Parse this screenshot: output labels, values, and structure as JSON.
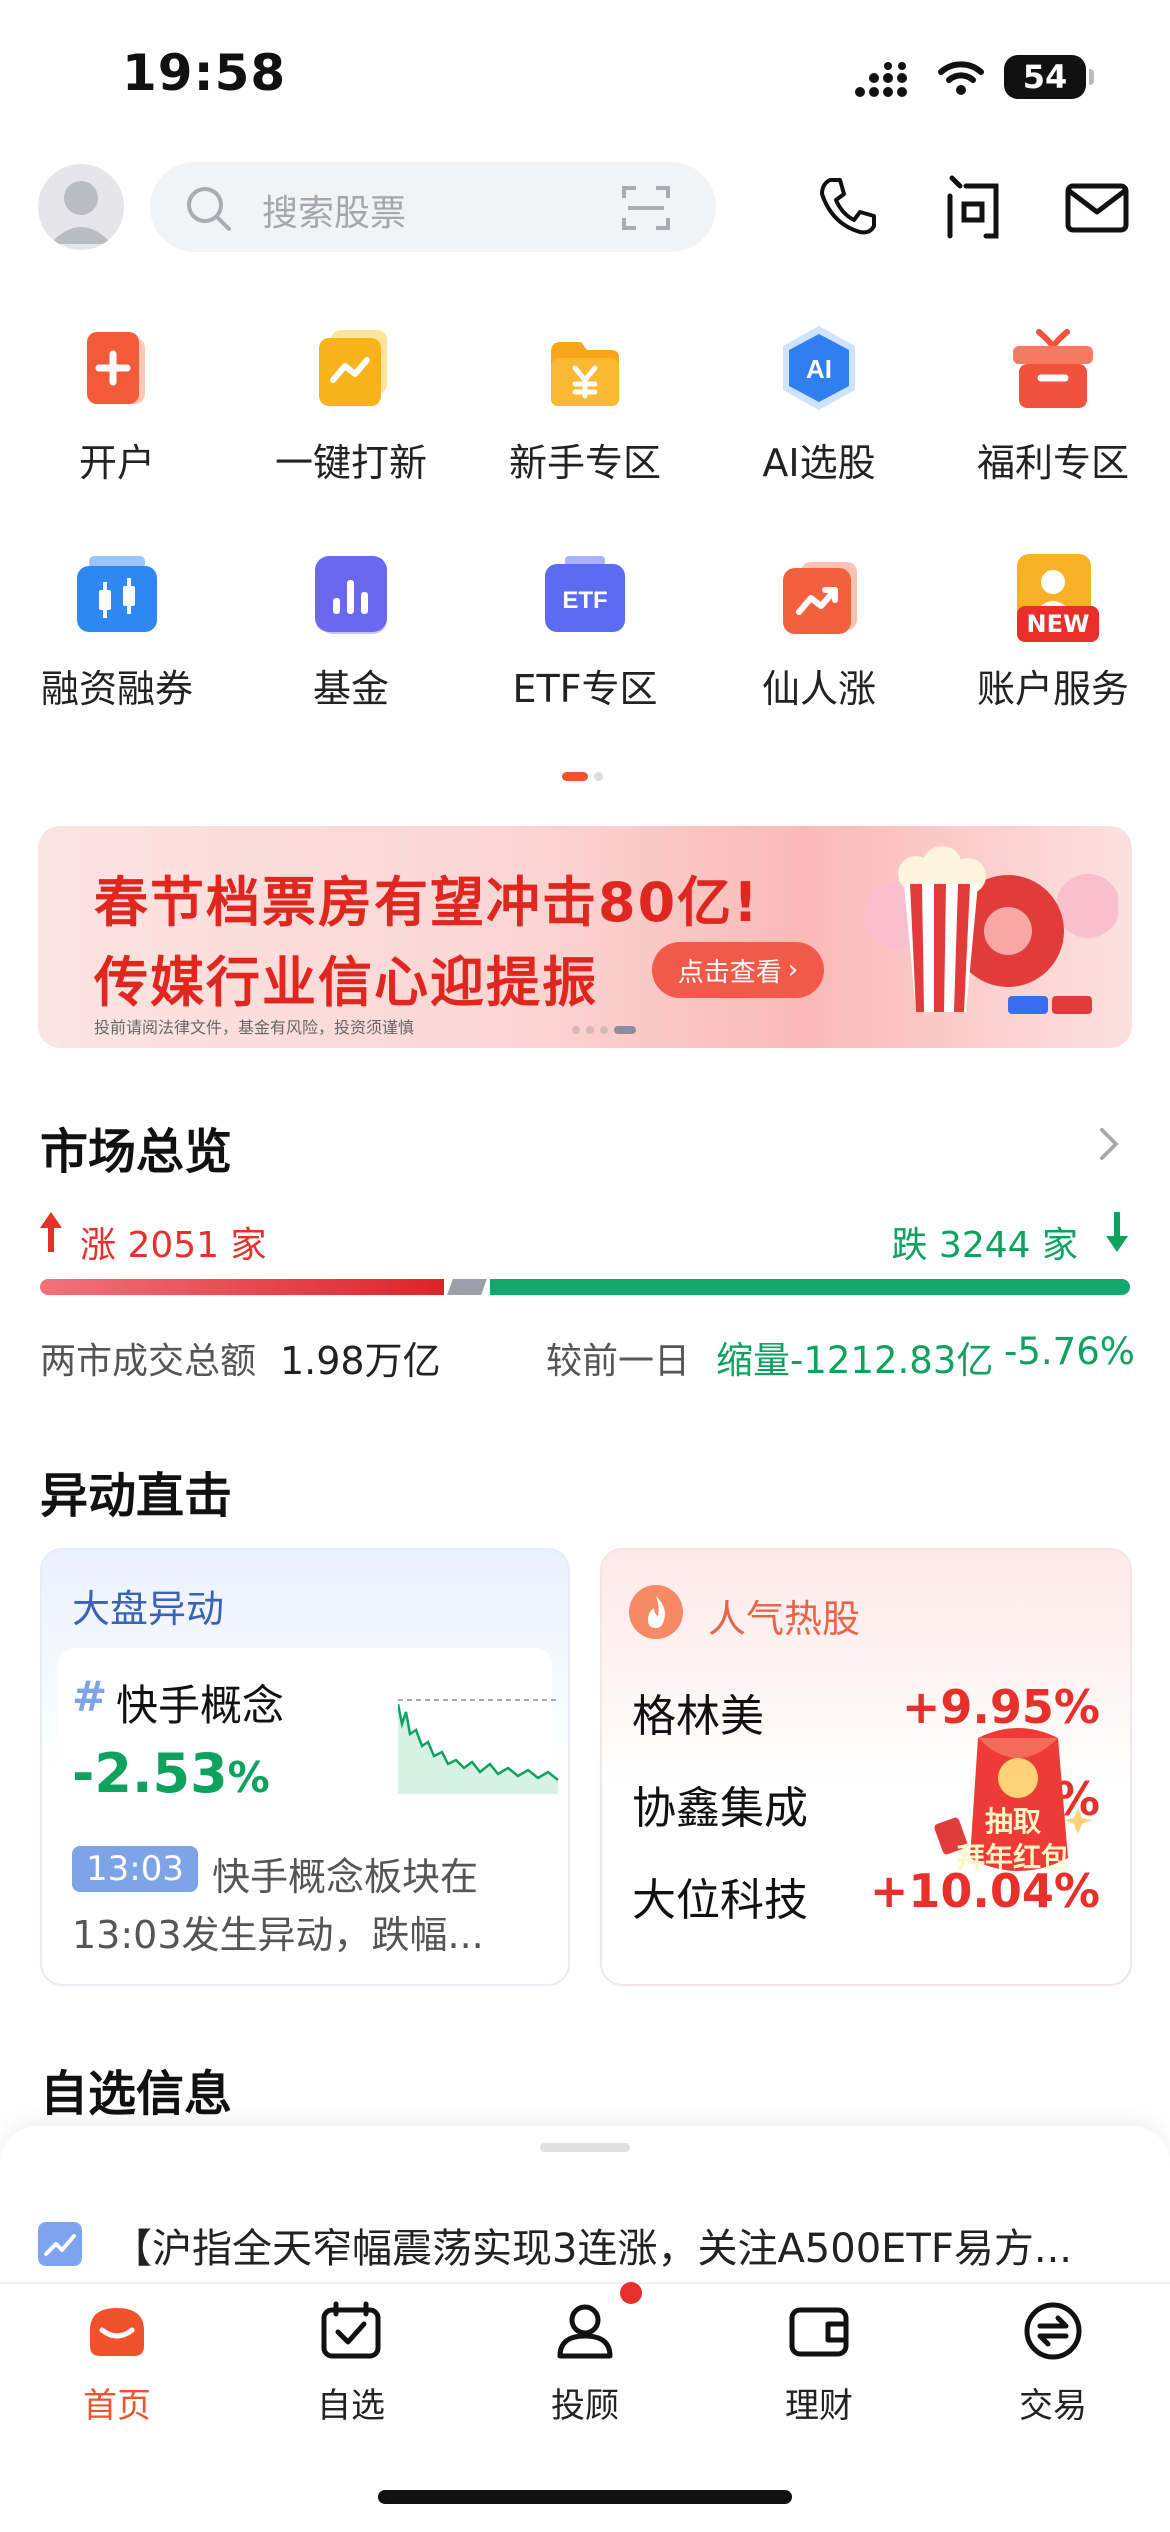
{
  "status_bar": {
    "time": "19:58",
    "battery": "54"
  },
  "header": {
    "search_placeholder": "搜索股票"
  },
  "shortcuts": [
    {
      "label": "开户",
      "icon": "open-account-icon"
    },
    {
      "label": "一键打新",
      "icon": "ipo-icon"
    },
    {
      "label": "新手专区",
      "icon": "newbie-icon"
    },
    {
      "label": "AI选股",
      "icon": "ai-pick-icon"
    },
    {
      "label": "福利专区",
      "icon": "gift-icon"
    },
    {
      "label": "融资融券",
      "icon": "margin-icon"
    },
    {
      "label": "基金",
      "icon": "fund-icon"
    },
    {
      "label": "ETF专区",
      "icon": "etf-icon"
    },
    {
      "label": "仙人涨",
      "icon": "rise-icon"
    },
    {
      "label": "账户服务",
      "icon": "account-service-icon",
      "badge": "NEW"
    }
  ],
  "banner": {
    "line1": "春节档票房有望冲击80亿!",
    "line2": "传媒行业信心迎提振",
    "button": "点击查看",
    "disclaimer": "投前请阅法律文件，基金有风险，投资须谨慎"
  },
  "market": {
    "title": "市场总览",
    "up": "涨 2051 家",
    "down": "跌 3244 家",
    "volume_label": "两市成交总额",
    "volume_value": "1.98万亿",
    "compare_label": "较前一日",
    "change_amount": "缩量-1212.83亿",
    "change_pct": "-5.76%",
    "up_count": 2051,
    "down_count": 3244
  },
  "movers": {
    "title": "异动直击",
    "left_card": {
      "title": "大盘异动",
      "hash": "#",
      "concept": "快手概念",
      "change": "-2.53",
      "pct_sign": "%",
      "time_tag": "13:03",
      "desc_line1": "快手概念板块在",
      "desc_line2": "13:03发生异动，跌幅..."
    },
    "right_card": {
      "title": "人气热股",
      "stocks": [
        {
          "name": "格林美",
          "pct": "+9.95%"
        },
        {
          "name": "协鑫集成",
          "pct": "%"
        },
        {
          "name": "大位科技",
          "pct": "+10.04%"
        }
      ],
      "promo_line1": "抽取",
      "promo_line2": "拜年红包"
    }
  },
  "watchlist": {
    "title": "自选信息",
    "news": "【沪指全天窄幅震荡实现3连涨，关注A500ETF易方..."
  },
  "tabs": [
    {
      "label": "首页",
      "active": true
    },
    {
      "label": "自选"
    },
    {
      "label": "投顾",
      "dot": true
    },
    {
      "label": "理财"
    },
    {
      "label": "交易"
    }
  ],
  "colors": {
    "accent": "#f0522c",
    "up": "#e8302b",
    "down": "#0ea25f"
  }
}
